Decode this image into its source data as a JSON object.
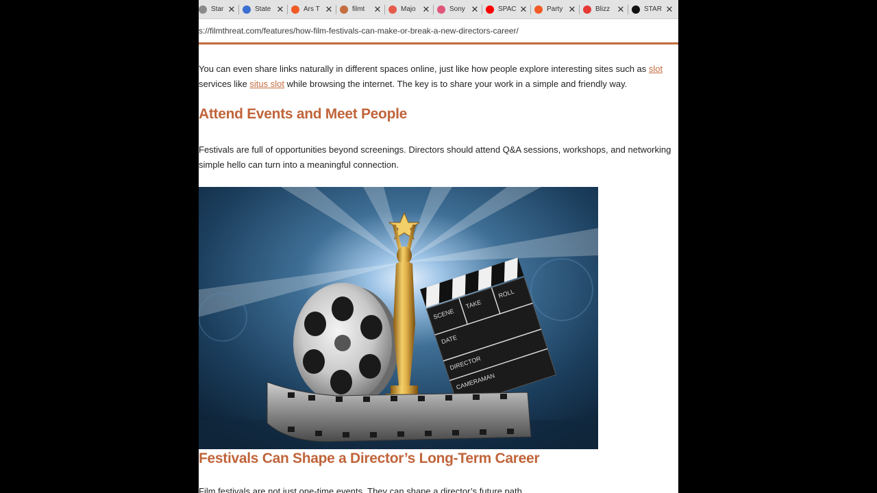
{
  "browser": {
    "tabs": [
      {
        "title": "Star",
        "icon": "star-icon",
        "color": "#8a8a8a"
      },
      {
        "title": "State",
        "icon": "playstation-icon",
        "color": "#3b6fd1"
      },
      {
        "title": "Ars T",
        "icon": "ars-icon",
        "color": "#f15a24"
      },
      {
        "title": "filmt",
        "icon": "chart-icon",
        "color": "#c46d3f"
      },
      {
        "title": "Majo",
        "icon": "circle-c-icon",
        "color": "#e65a4a"
      },
      {
        "title": "Sony",
        "icon": "pin-icon",
        "color": "#e0567a"
      },
      {
        "title": "SPAC",
        "icon": "youtube-icon",
        "color": "#ff0000"
      },
      {
        "title": "Party",
        "icon": "ars-icon",
        "color": "#f15a24"
      },
      {
        "title": "Blizz",
        "icon": "circle-c-icon",
        "color": "#e53935"
      },
      {
        "title": "STAR",
        "icon": "starwars-icon",
        "color": "#111111"
      }
    ],
    "close_glyph": "✕",
    "url": "s://filmthreat.com/features/how-film-festivals-can-make-or-break-a-new-directors-career/"
  },
  "article": {
    "para1": {
      "line1_before": "You can even share links naturally in different spaces online, just like how people explore interesting sites such as ",
      "line1_link": "slot",
      "line2_before": "services like ",
      "line2_link": "situs slot",
      "line2_after": " while browsing the internet. The key is to share your work in a simple and friendly way."
    },
    "heading1": "Attend Events and Meet People",
    "para2": {
      "line1": "Festivals are full of opportunities beyond screenings. Directors should attend Q&A sessions, workshops, and networking",
      "line2": "simple hello can turn into a meaningful connection."
    },
    "image": {
      "clapper_words": [
        "SCENE",
        "TAKE",
        "ROLL",
        "DATE",
        "DIRECTOR",
        "CAMERAMAN"
      ]
    },
    "heading2": "Festivals Can Shape a Director’s Long-Term Career",
    "para3": "Film festivals are not just one-time events. They can shape a director’s future path."
  },
  "colors": {
    "accent": "#c46d3f",
    "heading": "#c0643a"
  }
}
